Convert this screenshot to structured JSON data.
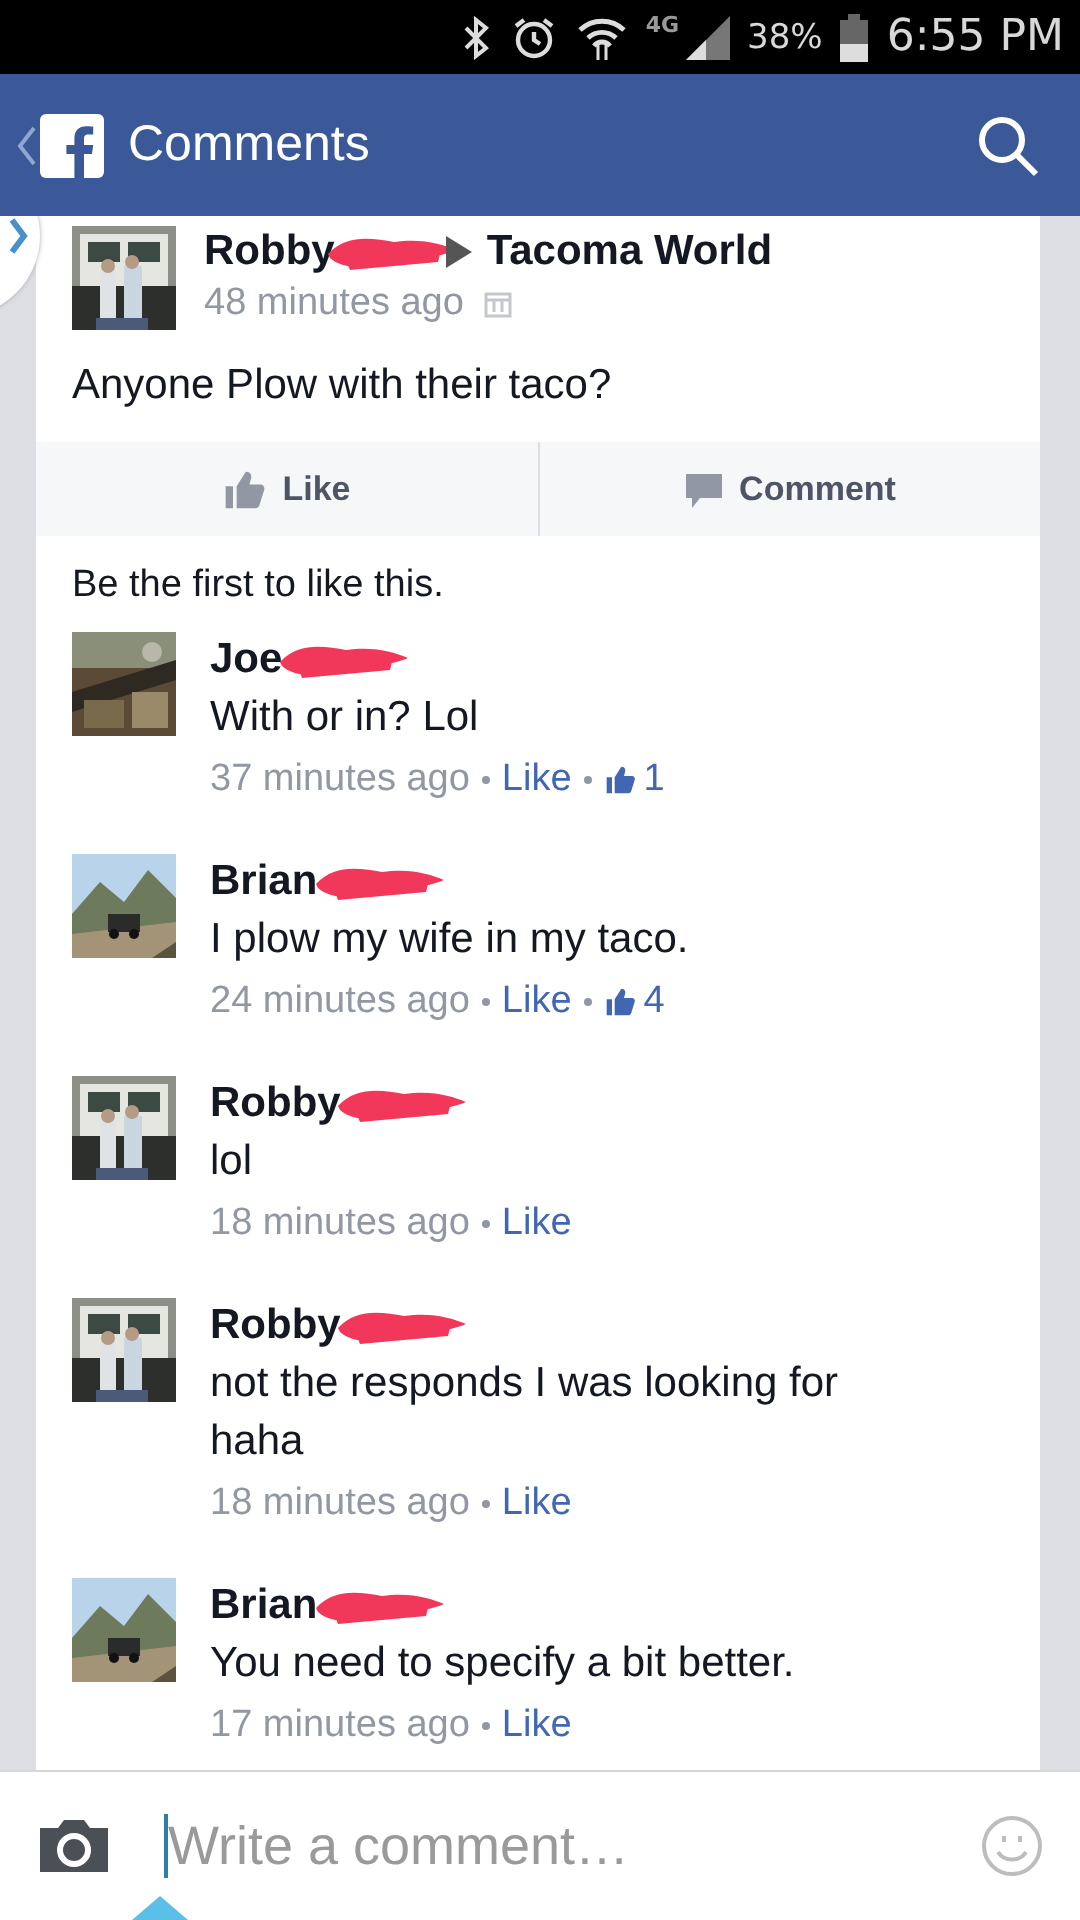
{
  "status_bar": {
    "network": "4G",
    "battery": "38%",
    "time": "6:55 PM"
  },
  "header": {
    "title": "Comments"
  },
  "post": {
    "author": "Robby",
    "redacted": true,
    "target": "Tacoma World",
    "time": "48 minutes ago",
    "text": "Anyone Plow with their taco?",
    "actions": [
      "Like",
      "Comment"
    ]
  },
  "likes_summary": "Be the first to like this.",
  "comments": [
    {
      "author": "Joe",
      "redacted": true,
      "text": "With or in? Lol",
      "time": "37 minutes ago",
      "like": "Like",
      "like_count": "1"
    },
    {
      "author": "Brian",
      "redacted": true,
      "text": "I plow my wife in my taco.",
      "time": "24 minutes ago",
      "like": "Like",
      "like_count": "4"
    },
    {
      "author": "Robby",
      "redacted": true,
      "text": "lol",
      "time": "18 minutes ago",
      "like": "Like"
    },
    {
      "author": "Robby",
      "redacted": true,
      "text": "not the responds I was looking for haha",
      "time": "18 minutes ago",
      "like": "Like"
    },
    {
      "author": "Brian",
      "redacted": true,
      "text": "You need to specify a bit better.",
      "time": "17 minutes ago",
      "like": "Like"
    }
  ],
  "composer": {
    "placeholder": "Write a comment…"
  }
}
